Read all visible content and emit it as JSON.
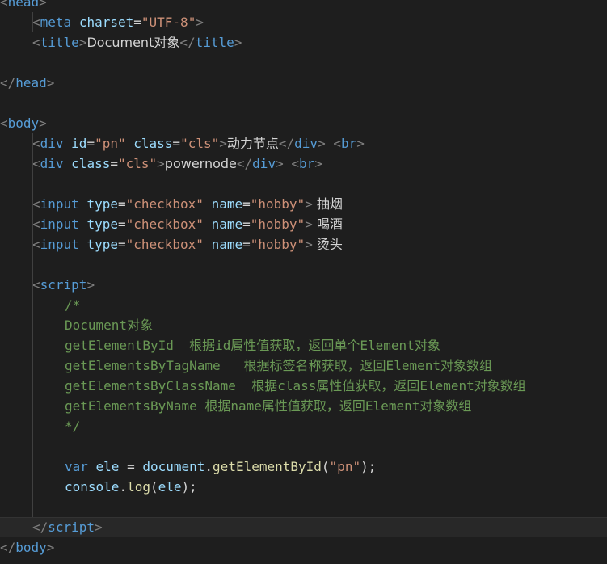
{
  "editor": {
    "language": "html",
    "colors": {
      "background": "#1e1e1e",
      "tag": "#569cd6",
      "attribute": "#9cdcfe",
      "string": "#ce9178",
      "comment": "#6a9955",
      "function": "#dcdcaa",
      "text": "#d4d4d4",
      "bracket": "#808080"
    },
    "lines": [
      [
        [
          "br",
          "<"
        ],
        [
          "tag",
          "head"
        ],
        [
          "br",
          ">"
        ]
      ],
      [
        [
          "br",
          "<"
        ],
        [
          "tag",
          "meta "
        ],
        [
          "attr",
          "charset"
        ],
        [
          "eq",
          "="
        ],
        [
          "str",
          "\"UTF-8\""
        ],
        [
          "br",
          ">"
        ]
      ],
      [
        [
          "br",
          "<"
        ],
        [
          "tag",
          "title"
        ],
        [
          "br",
          ">"
        ],
        [
          "txt",
          "Document对象"
        ],
        [
          "br",
          "</"
        ],
        [
          "tag",
          "title"
        ],
        [
          "br",
          ">"
        ]
      ],
      [],
      [
        [
          "br",
          "</"
        ],
        [
          "tag",
          "head"
        ],
        [
          "br",
          ">"
        ]
      ],
      [],
      [
        [
          "br",
          "<"
        ],
        [
          "tag",
          "body"
        ],
        [
          "br",
          ">"
        ]
      ],
      [
        [
          "br",
          "<"
        ],
        [
          "tag",
          "div "
        ],
        [
          "attr",
          "id"
        ],
        [
          "eq",
          "="
        ],
        [
          "str",
          "\"pn\""
        ],
        [
          "pun",
          " "
        ],
        [
          "attr",
          "class"
        ],
        [
          "eq",
          "="
        ],
        [
          "str",
          "\"cls\""
        ],
        [
          "br",
          ">"
        ],
        [
          "txt",
          "动力节点"
        ],
        [
          "br",
          "</"
        ],
        [
          "tag",
          "div"
        ],
        [
          "br",
          ">"
        ],
        [
          "pun",
          " "
        ],
        [
          "br",
          "<"
        ],
        [
          "tag",
          "br"
        ],
        [
          "br",
          ">"
        ]
      ],
      [
        [
          "br",
          "<"
        ],
        [
          "tag",
          "div "
        ],
        [
          "attr",
          "class"
        ],
        [
          "eq",
          "="
        ],
        [
          "str",
          "\"cls\""
        ],
        [
          "br",
          ">"
        ],
        [
          "txt",
          "powernode"
        ],
        [
          "br",
          "</"
        ],
        [
          "tag",
          "div"
        ],
        [
          "br",
          ">"
        ],
        [
          "pun",
          " "
        ],
        [
          "br",
          "<"
        ],
        [
          "tag",
          "br"
        ],
        [
          "br",
          ">"
        ]
      ],
      [],
      [
        [
          "br",
          "<"
        ],
        [
          "tag",
          "input "
        ],
        [
          "attr",
          "type"
        ],
        [
          "eq",
          "="
        ],
        [
          "str",
          "\"checkbox\""
        ],
        [
          "pun",
          " "
        ],
        [
          "attr",
          "name"
        ],
        [
          "eq",
          "="
        ],
        [
          "str",
          "\"hobby\""
        ],
        [
          "br",
          ">"
        ],
        [
          "txt",
          " 抽烟"
        ]
      ],
      [
        [
          "br",
          "<"
        ],
        [
          "tag",
          "input "
        ],
        [
          "attr",
          "type"
        ],
        [
          "eq",
          "="
        ],
        [
          "str",
          "\"checkbox\""
        ],
        [
          "pun",
          " "
        ],
        [
          "attr",
          "name"
        ],
        [
          "eq",
          "="
        ],
        [
          "str",
          "\"hobby\""
        ],
        [
          "br",
          ">"
        ],
        [
          "txt",
          " 喝酒"
        ]
      ],
      [
        [
          "br",
          "<"
        ],
        [
          "tag",
          "input "
        ],
        [
          "attr",
          "type"
        ],
        [
          "eq",
          "="
        ],
        [
          "str",
          "\"checkbox\""
        ],
        [
          "pun",
          " "
        ],
        [
          "attr",
          "name"
        ],
        [
          "eq",
          "="
        ],
        [
          "str",
          "\"hobby\""
        ],
        [
          "br",
          ">"
        ],
        [
          "txt",
          " 烫头"
        ]
      ],
      [],
      [
        [
          "br",
          "<"
        ],
        [
          "tag",
          "script"
        ],
        [
          "br",
          ">"
        ]
      ],
      [
        [
          "cmt",
          "/*"
        ]
      ],
      [
        [
          "cmt",
          "Document对象"
        ]
      ],
      [
        [
          "cmt",
          "getElementById  根据id属性值获取，返回单个Element对象"
        ]
      ],
      [
        [
          "cmt",
          "getElementsByTagName   根据标签名称获取，返回Element对象数组"
        ]
      ],
      [
        [
          "cmt",
          "getElementsByClassName  根据class属性值获取，返回Element对象数组"
        ]
      ],
      [
        [
          "cmt",
          "getElementsByName 根据name属性值获取，返回Element对象数组"
        ]
      ],
      [
        [
          "cmt",
          "*/"
        ]
      ],
      [],
      [
        [
          "kw",
          "var "
        ],
        [
          "id",
          "ele"
        ],
        [
          "pun",
          " = "
        ],
        [
          "id",
          "document"
        ],
        [
          "pun",
          "."
        ],
        [
          "fn",
          "getElementById"
        ],
        [
          "pun",
          "("
        ],
        [
          "str",
          "\"pn\""
        ],
        [
          "pun",
          ");"
        ]
      ],
      [
        [
          "id",
          "console"
        ],
        [
          "pun",
          "."
        ],
        [
          "fn",
          "log"
        ],
        [
          "pun",
          "("
        ],
        [
          "id",
          "ele"
        ],
        [
          "pun",
          ");"
        ]
      ],
      [],
      [
        [
          "br",
          "</"
        ],
        [
          "tag",
          "script"
        ],
        [
          "br",
          ">"
        ]
      ],
      [
        [
          "br",
          "</"
        ],
        [
          "tag",
          "body"
        ],
        [
          "br",
          ">"
        ]
      ]
    ]
  }
}
